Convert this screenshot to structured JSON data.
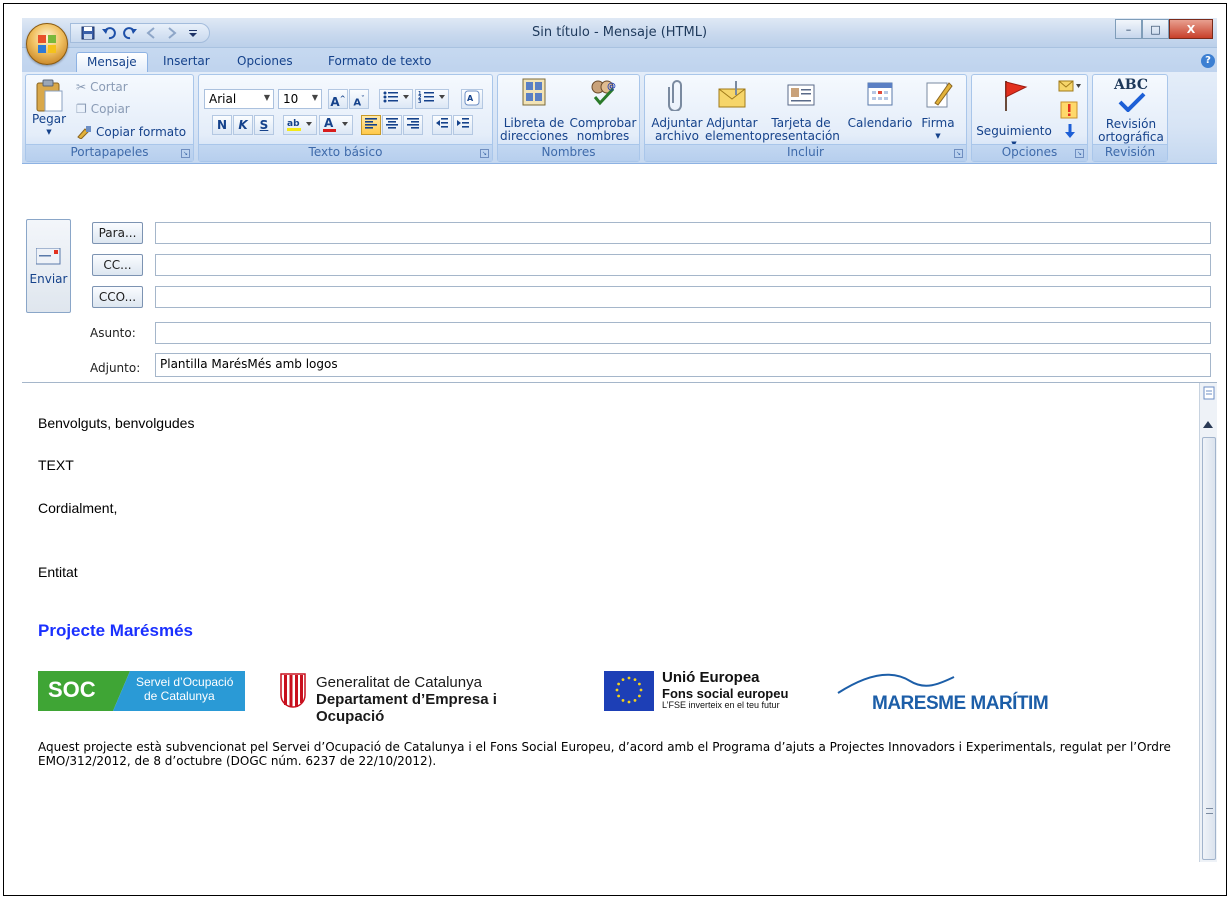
{
  "window": {
    "title": "Sin título - Mensaje (HTML)",
    "controls": {
      "minimize": "–",
      "maximize": "□",
      "close": "X"
    }
  },
  "tabs": [
    {
      "label": "Mensaje",
      "active": true
    },
    {
      "label": "Insertar",
      "active": false
    },
    {
      "label": "Opciones",
      "active": false
    },
    {
      "label": "Formato de texto",
      "active": false
    }
  ],
  "ribbon": {
    "portapapeles": {
      "label": "Portapapeles",
      "paste": "Pegar",
      "cut": "Cortar",
      "copy": "Copiar",
      "format_painter": "Copiar formato"
    },
    "texto_basico": {
      "label": "Texto básico",
      "font": "Arial",
      "size": "10",
      "bold": "N",
      "italic": "K",
      "underline": "S"
    },
    "nombres": {
      "label": "Nombres",
      "address_book_line1": "Libreta de",
      "address_book_line2": "direcciones",
      "check_names_line1": "Comprobar",
      "check_names_line2": "nombres"
    },
    "incluir": {
      "label": "Incluir",
      "attach_file_line1": "Adjuntar",
      "attach_file_line2": "archivo",
      "attach_item_line1": "Adjuntar",
      "attach_item_line2": "elemento",
      "business_card_line1": "Tarjeta de",
      "business_card_line2": "presentación",
      "calendar": "Calendario",
      "signature": "Firma"
    },
    "opciones": {
      "label": "Opciones",
      "follow_up": "Seguimiento"
    },
    "revision": {
      "label": "Revisión",
      "spelling_line1": "Revisión",
      "spelling_line2": "ortográfica",
      "abc": "ABC"
    }
  },
  "header": {
    "send": "Enviar",
    "to_button": "Para...",
    "cc_button": "CC...",
    "bcc_button": "CCO...",
    "subject_label": "Asunto:",
    "attachment_label": "Adjunto:",
    "to_value": "",
    "cc_value": "",
    "bcc_value": "",
    "subject_value": "",
    "attachment_value": "Plantilla MarésMés amb logos"
  },
  "body": {
    "greeting": "Benvolguts, benvolgudes",
    "text": "TEXT",
    "closing": "Cordialment,",
    "entity": "Entitat",
    "project_title": "Projecte Marésmés",
    "disclaimer": "Aquest projecte està subvencionat pel Servei d’Ocupació de Catalunya i el Fons Social Europeu, d’acord amb el Programa d’ajuts a Projectes Innovadors i Experimentals, regulat per l’Ordre EMO/312/2012, de 8 d’octubre (DOGC núm. 6237 de 22/10/2012)."
  },
  "logos": {
    "soc": {
      "abbr": "SOC",
      "line1": "Servei d’Ocupació",
      "line2": "de Catalunya"
    },
    "generalitat": {
      "line1": "Generalitat de Catalunya",
      "line2": "Departament d’Empresa i Ocupació"
    },
    "eu": {
      "line1": "Unió Europea",
      "line2": "Fons social europeu",
      "line3": "L’FSE inverteix en el teu futur"
    },
    "maresme": {
      "text": "MARESME MARÍTIM"
    }
  },
  "colors": {
    "soc_green": "#3fa535",
    "soc_blue": "#2a9ad6",
    "eu_blue": "#1d3fb6",
    "project_title": "#1a30ff",
    "maresme_blue": "#1c5ea8"
  }
}
